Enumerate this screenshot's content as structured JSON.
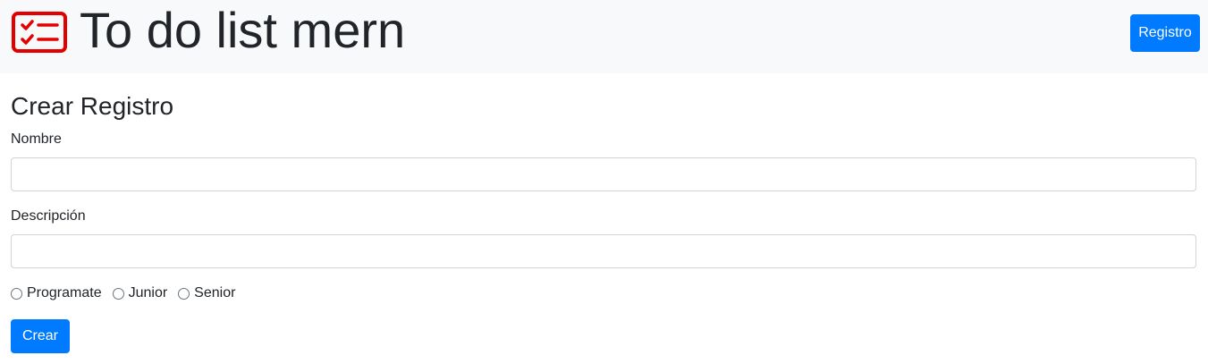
{
  "header": {
    "brand_icon": "checklist-icon",
    "brand_icon_color": "#e50000",
    "title": "To do list mern",
    "nav_button_label": "Registro"
  },
  "form": {
    "title": "Crear Registro",
    "fields": [
      {
        "label": "Nombre",
        "value": "",
        "placeholder": ""
      },
      {
        "label": "Descripción",
        "value": "",
        "placeholder": ""
      }
    ],
    "radio_options": [
      {
        "label": "Programate",
        "checked": false
      },
      {
        "label": "Junior",
        "checked": false
      },
      {
        "label": "Senior",
        "checked": false
      }
    ],
    "submit_label": "Crear"
  },
  "colors": {
    "navbar_bg": "#f8f9fa",
    "primary": "#007bff",
    "text": "#212529",
    "input_border": "#ced4da"
  }
}
